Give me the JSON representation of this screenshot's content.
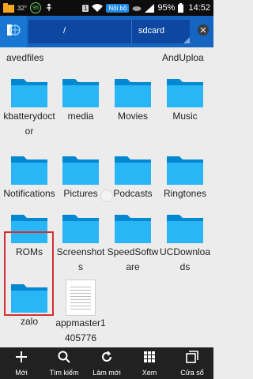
{
  "status_bar": {
    "temperature": "32°",
    "badge_count": "95",
    "sim": "1",
    "network_label": "Nội bộ",
    "battery_percent": "95%",
    "time": "14:52"
  },
  "address_bar": {
    "root": "/",
    "current": "sdcard"
  },
  "top_partial": {
    "left": "avedfiles",
    "right": "AndUploa"
  },
  "items": [
    {
      "name": "kbatterydoctor",
      "type": "folder"
    },
    {
      "name": "media",
      "type": "folder"
    },
    {
      "name": "Movies",
      "type": "folder"
    },
    {
      "name": "Music",
      "type": "folder"
    },
    {
      "name": "Notifications",
      "type": "folder"
    },
    {
      "name": "Pictures",
      "type": "folder"
    },
    {
      "name": "Podcasts",
      "type": "folder"
    },
    {
      "name": "Ringtones",
      "type": "folder"
    },
    {
      "name": "ROMs",
      "type": "folder"
    },
    {
      "name": "Screenshots",
      "type": "folder"
    },
    {
      "name": "SpeedSoftware",
      "type": "folder"
    },
    {
      "name": "UCDownloads",
      "type": "folder"
    },
    {
      "name": "zalo",
      "type": "folder"
    },
    {
      "name": "appmaster1405776",
      "type": "file"
    }
  ],
  "toolbar": {
    "new": "Mới",
    "search": "Tìm kiếm",
    "refresh": "Làm mới",
    "view": "Xem",
    "windows": "Cửa sổ"
  },
  "colors": {
    "folder": "#29b6f6",
    "folder_back": "#0288d1",
    "highlight": "#d32f2f",
    "addr_bg": "#1565c0"
  }
}
